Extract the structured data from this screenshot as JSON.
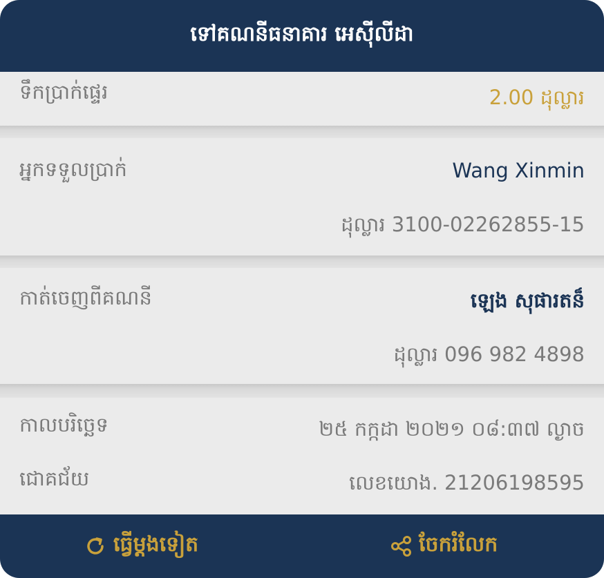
{
  "header": {
    "title": "ទៅគណនីធនាគារ អេស៊ីលីដា"
  },
  "amount": {
    "label": "ទឹកប្រាក់ផ្ទេរ",
    "value": "2.00 ដុល្លារ"
  },
  "recipient": {
    "label": "អ្នកទទួលប្រាក់",
    "name": "Wang Xinmin",
    "account": "ដុល្លារ 3100-02262855-15"
  },
  "source": {
    "label": "កាត់ចេញពីគណនី",
    "name": "ឡេង សុផារតន៏",
    "account": "ដុល្លារ 096 982 4898"
  },
  "details": {
    "date_label": "កាលបរិច្ឆេទ",
    "date_value": "២៥ កក្កដា ២០២១ ០៨:៣៧ ល្ងាច",
    "status_label": "ជោគជ័យ",
    "reference_value": "លេខយោង. 21206198595"
  },
  "footer": {
    "repeat_label": "ធ្វើម្តងទៀត",
    "share_label": "ចែករំលែក",
    "repeat_icon": "refresh-icon",
    "share_icon": "share-icon"
  },
  "colors": {
    "navy": "#1b3455",
    "gold": "#c9a13b",
    "gray_text": "#7a7a7a",
    "panel": "#ebebeb"
  }
}
